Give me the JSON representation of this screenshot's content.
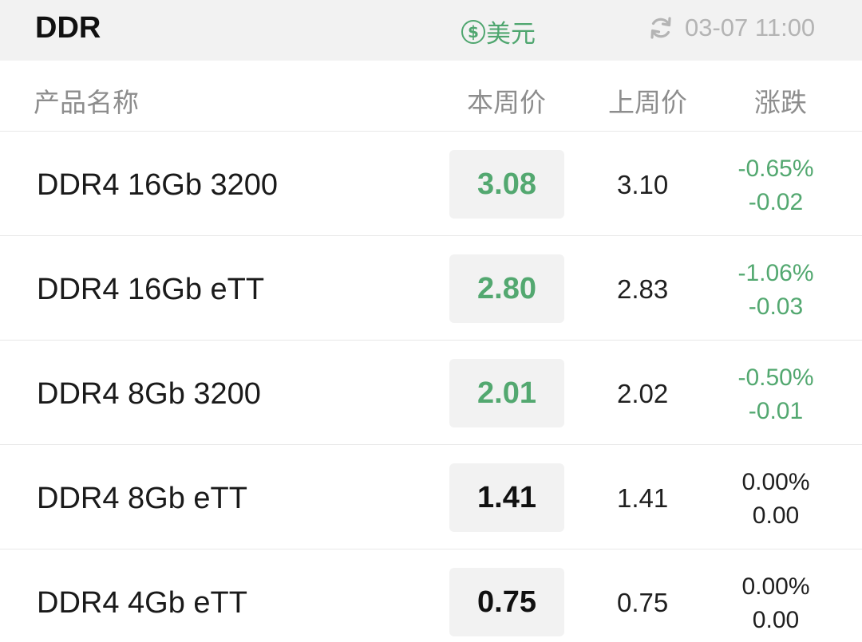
{
  "header": {
    "title": "DDR",
    "currency_label": "美元",
    "currency_icon": "dollar-circle-icon",
    "refresh_icon": "refresh-icon",
    "timestamp": "03-07 11:00"
  },
  "columns": {
    "name": "产品名称",
    "this_week": "本周价",
    "last_week": "上周价",
    "change": "涨跌"
  },
  "colors": {
    "down_green": "#53a870",
    "neutral": "#111111"
  },
  "rows": [
    {
      "name": "DDR4 16Gb 3200",
      "this_week": "3.08",
      "last_week": "3.10",
      "change_pct": "-0.65%",
      "change_abs": "-0.02",
      "trend": "down"
    },
    {
      "name": "DDR4 16Gb eTT",
      "this_week": "2.80",
      "last_week": "2.83",
      "change_pct": "-1.06%",
      "change_abs": "-0.03",
      "trend": "down"
    },
    {
      "name": "DDR4 8Gb 3200",
      "this_week": "2.01",
      "last_week": "2.02",
      "change_pct": "-0.50%",
      "change_abs": "-0.01",
      "trend": "down"
    },
    {
      "name": "DDR4 8Gb eTT",
      "this_week": "1.41",
      "last_week": "1.41",
      "change_pct": "0.00%",
      "change_abs": "0.00",
      "trend": "flat"
    },
    {
      "name": "DDR4 4Gb eTT",
      "this_week": "0.75",
      "last_week": "0.75",
      "change_pct": "0.00%",
      "change_abs": "0.00",
      "trend": "flat"
    }
  ]
}
